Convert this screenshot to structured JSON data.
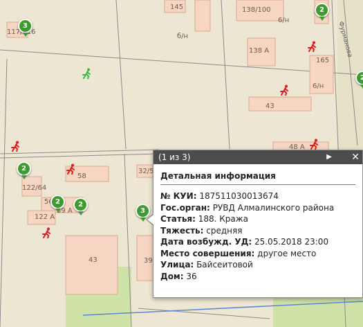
{
  "map": {
    "building_labels": [
      "145",
      "138/100",
      "6/н",
      "117/116",
      "б/н",
      "138 А",
      "165",
      "6/н",
      "43",
      "48 А",
      "58",
      "32/5",
      "122/64",
      "56",
      "39 А",
      "122 А",
      "43",
      "39"
    ],
    "street_label": "Фурманова",
    "cluster_badges": [
      "3",
      "2",
      "2",
      "2",
      "2",
      "3",
      "2"
    ],
    "colors": {
      "background": "#ede6d2",
      "building_fill": "#f6d6c2",
      "building_stroke": "#d9a98e",
      "green_area": "#cfe2a8",
      "badge_green": "#3f9a2f",
      "crime_marker": "#e01b1b",
      "event_marker": "#2fbf3a"
    }
  },
  "popup": {
    "counter": "(1 из 3)",
    "next_icon": "▶",
    "close_icon": "✕",
    "title": "Детальная информация",
    "fields": [
      {
        "label": "№ КУИ:",
        "value": "187511030013674"
      },
      {
        "label": "Гос.орган:",
        "value": "РУВД Алмалинского района"
      },
      {
        "label": "Статья:",
        "value": "188. Кража"
      },
      {
        "label": "Тяжесть:",
        "value": "средняя"
      },
      {
        "label": "Дата возбужд. УД:",
        "value": "25.05.2018 23:00"
      },
      {
        "label": "Место совершения:",
        "value": "другое место"
      },
      {
        "label": "Улица:",
        "value": "Байсеитовой"
      },
      {
        "label": "Дом:",
        "value": "36"
      }
    ]
  }
}
